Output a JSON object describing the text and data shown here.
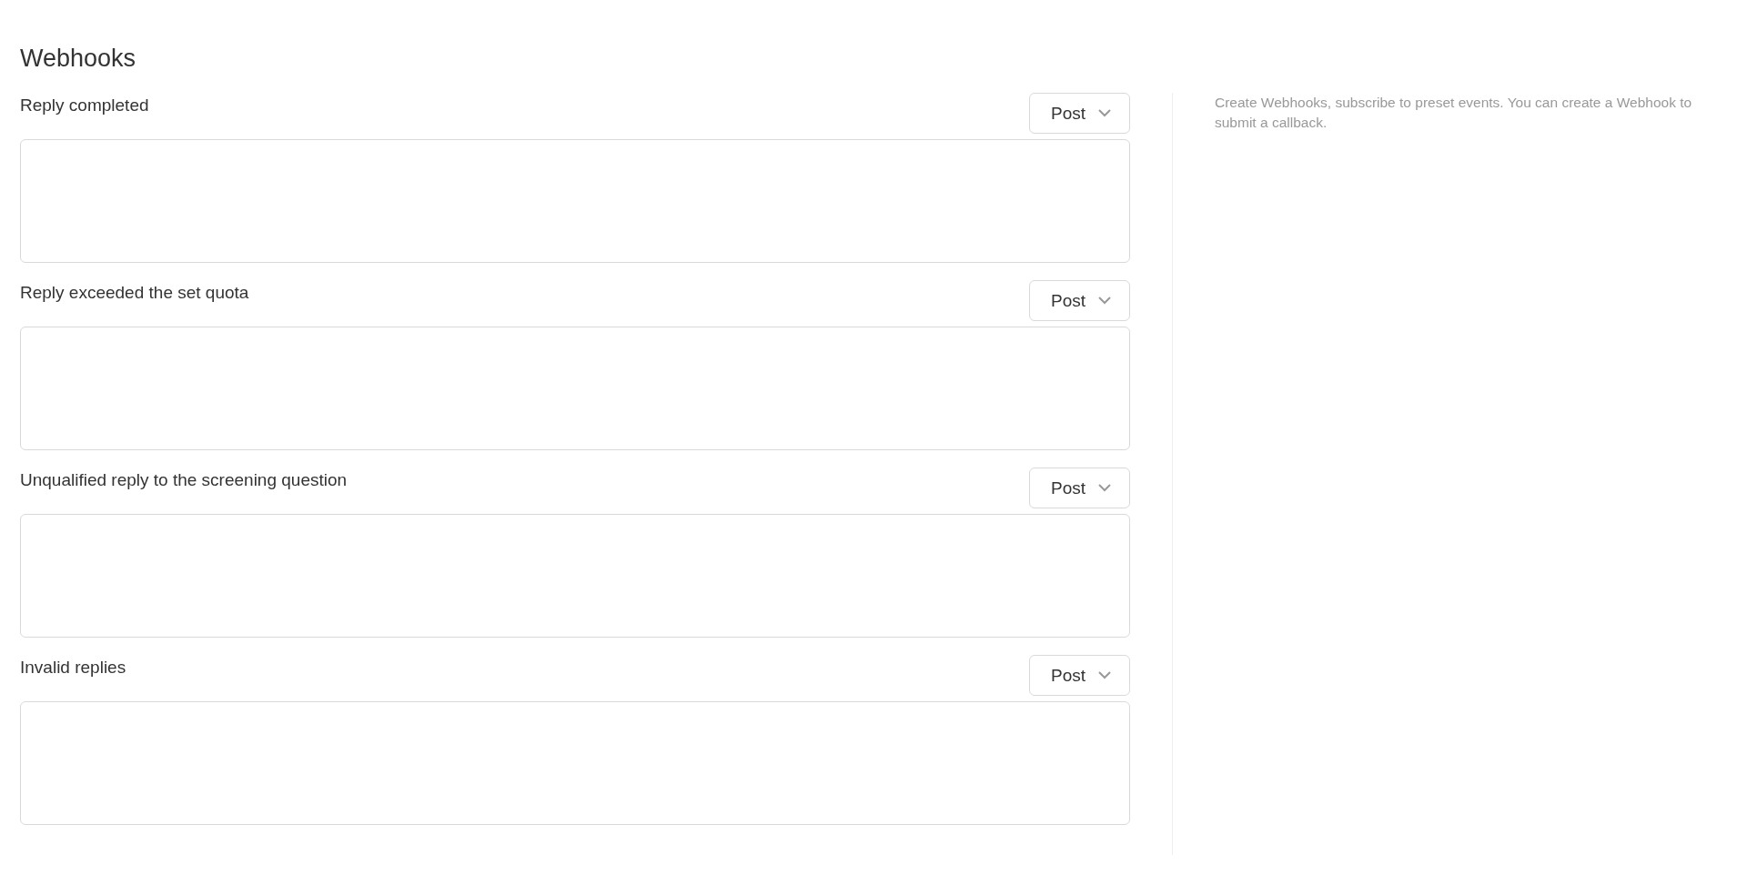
{
  "title": "Webhooks",
  "webhooks": [
    {
      "label": "Reply completed",
      "method": "Post"
    },
    {
      "label": "Reply exceeded the set quota",
      "method": "Post"
    },
    {
      "label": "Unqualified reply to the screening question",
      "method": "Post"
    },
    {
      "label": "Invalid replies",
      "method": "Post"
    }
  ],
  "help_text": "Create Webhooks, subscribe to preset events. You can create a Webhook to submit a callback."
}
